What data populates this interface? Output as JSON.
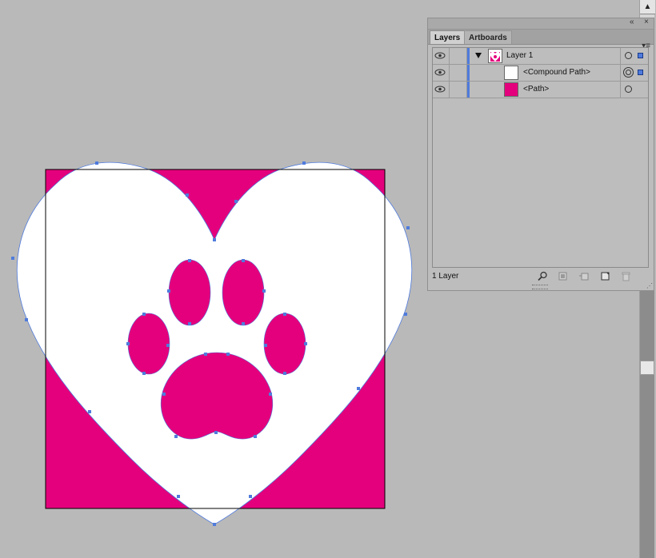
{
  "panel": {
    "tabs": [
      {
        "label": "Layers",
        "active": true
      },
      {
        "label": "Artboards",
        "active": false
      }
    ],
    "collapse_icon": "double-chevron-left-icon",
    "close_icon": "close-icon",
    "menu_icon": "panel-menu-icon",
    "rows": [
      {
        "name": "Layer 1",
        "thumbnail": "layer-thumbnail",
        "expanded": true
      },
      {
        "name": "<Compound Path>",
        "thumbnail_color": "#ffffff",
        "target": "double-circle"
      },
      {
        "name": "<Path>",
        "thumbnail_color": "#e4007c",
        "target": "circle"
      }
    ],
    "footer": {
      "count": "1 Layer",
      "icons": [
        "locate-object-icon",
        "make-clipping-mask-icon",
        "create-sublayer-icon",
        "create-new-layer-icon",
        "delete-icon"
      ]
    }
  },
  "colors": {
    "accent": "#4f7bdc",
    "magenta": "#e4007c",
    "canvas": "#b9b9b9"
  },
  "artwork": {
    "shapes": [
      "magenta-square",
      "heart-compound-path",
      "paw-print-cutout"
    ]
  }
}
